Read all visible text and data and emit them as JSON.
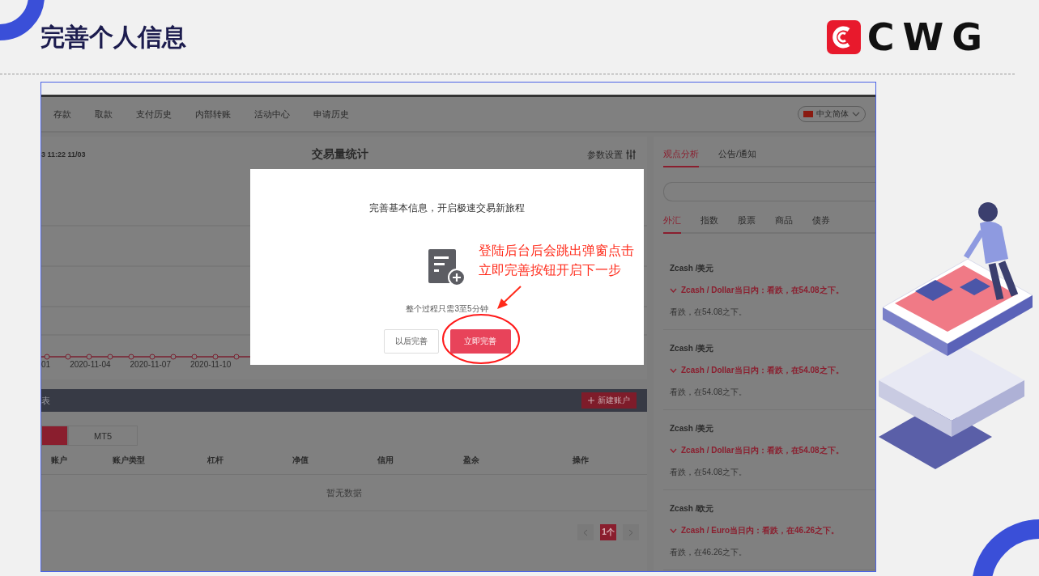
{
  "slide": {
    "title": "完善个人信息",
    "logo_text": "CWG"
  },
  "nav": {
    "items": [
      "存款",
      "取款",
      "支付历史",
      "内部转账",
      "活动中心",
      "申请历史"
    ],
    "language": "中文简体"
  },
  "stats": {
    "timestamp": "3 11:22 11/03",
    "title": "交易量统计",
    "settings": "参数设置",
    "x_labels": [
      "01",
      "2020-11-04",
      "2020-11-07",
      "2020-11-10"
    ]
  },
  "accounts": {
    "header": "表",
    "new_button": "新建账户",
    "tabs": [
      {
        "selected": true
      },
      {
        "label": "MT5",
        "selected": false
      }
    ],
    "columns": [
      "账户",
      "账户类型",
      "杠杆",
      "净值",
      "信用",
      "盈余",
      "操作"
    ],
    "empty": "暂无数据",
    "page": "1个"
  },
  "analysis": {
    "tabs": [
      {
        "label": "观点分析",
        "selected": true
      },
      {
        "label": "公告/通知",
        "selected": false
      }
    ],
    "categories": [
      {
        "label": "外汇",
        "selected": true
      },
      {
        "label": "指数",
        "selected": false
      },
      {
        "label": "股票",
        "selected": false
      },
      {
        "label": "商品",
        "selected": false
      },
      {
        "label": "债券",
        "selected": false
      }
    ],
    "items": [
      {
        "title": "Zcash /美元",
        "summary": "Zcash / Dollar当日内：看跌，在54.08之下。",
        "detail": "看跌，在54.08之下。"
      },
      {
        "title": "Zcash /美元",
        "summary": "Zcash / Dollar当日内：看跌，在54.08之下。",
        "detail": "看跌，在54.08之下。"
      },
      {
        "title": "Zcash /美元",
        "summary": "Zcash / Dollar当日内：看跌，在54.08之下。",
        "detail": "看跌，在54.08之下。"
      },
      {
        "title": "Zcash /欧元",
        "summary": "Zcash / Euro当日内：看跌，在46.26之下。",
        "detail": "看跌，在46.26之下。"
      }
    ]
  },
  "modal": {
    "title": "完善基本信息，开启极速交易新旅程",
    "hint": "整个过程只需3至5分钟",
    "buttons": [
      {
        "label": "以后完善",
        "kind": "secondary"
      },
      {
        "label": "立即完善",
        "kind": "primary"
      }
    ]
  },
  "annotation": {
    "text": "登陆后台后会跳出弹窗点击立即完善按钮开启下一步"
  }
}
